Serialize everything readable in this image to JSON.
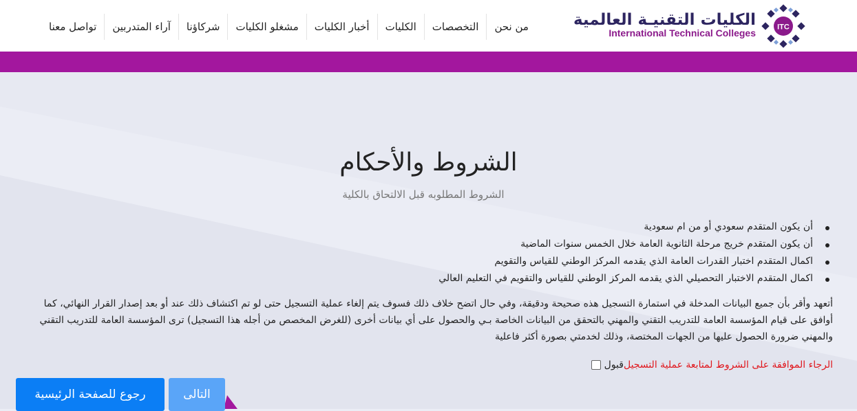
{
  "header": {
    "logo_ar": "الكليات التقنيـة العالمية",
    "logo_en": "International Technical Colleges",
    "logo_mark": "ITC",
    "nav": [
      {
        "label": "تواصل معنا",
        "name": "nav-contact"
      },
      {
        "label": "آراء المتدربين",
        "name": "nav-trainee-opinions"
      },
      {
        "label": "شركاؤنا",
        "name": "nav-partners"
      },
      {
        "label": "مشغلو الكليات",
        "name": "nav-operators"
      },
      {
        "label": "أخبار الكليات",
        "name": "nav-news"
      },
      {
        "label": "الكليات",
        "name": "nav-colleges"
      },
      {
        "label": "التخصصات",
        "name": "nav-specializations"
      },
      {
        "label": "من نحن",
        "name": "nav-about"
      }
    ]
  },
  "main": {
    "title": "الشروط والأحكام",
    "subtitle": "الشروط المطلوبه قبل الالتحاق بالكلية",
    "requirements": [
      "أن يكون المتقدم سعودي أو من ام سعودية",
      "أن يكون المتقدم خريج مرحلة الثانوية العامة خلال الخمس سنوات الماضية",
      "اكمال المتقدم اختبار القدرات العامة الذي يقدمه المركز الوطني للقياس والتقويم",
      "اكمال المتقدم الاختبار التحصيلي الذي يقدمه المركز الوطني للقياس والتقويم في التعليم العالي"
    ],
    "pledge": "أتعهد وأقر بأن جميع البيانات المدخلة في استمارة التسجيل هذه صحيحة ودقيقة، وفي حال اتضح خلاف ذلك فسوف يتم إلغاء عملية التسجيل حتى لو تم اكتشاف ذلك عند أو بعد إصدار القرار النهائي، كما أوافق على قيام المؤسسة العامة للتدريب التقني والمهني بالتحقق من البيانات الخاصة بـي والحصول على أي بيانات أخرى (للغرض المخصص من أجله هذا التسجيل) ترى المؤسسة العامة للتدريب التقني والمهني ضرورة الحصول عليها من الجهات المختصة، وذلك لخدمتي بصورة أكثر فاعلية",
    "accept_label": "قبول",
    "accept_note": "الرجاء الموافقة على الشروط لمتابعة عملية التسجيل",
    "accept_checked": false
  },
  "buttons": {
    "next": "التالى",
    "home": "رجوع للصفحة الرئيسية"
  },
  "colors": {
    "purple": "#a3179e",
    "navy": "#2d2560",
    "primary_button": "#0b7ef5",
    "disabled_button": "#5aa5f8",
    "warning_text": "#e0161c"
  }
}
